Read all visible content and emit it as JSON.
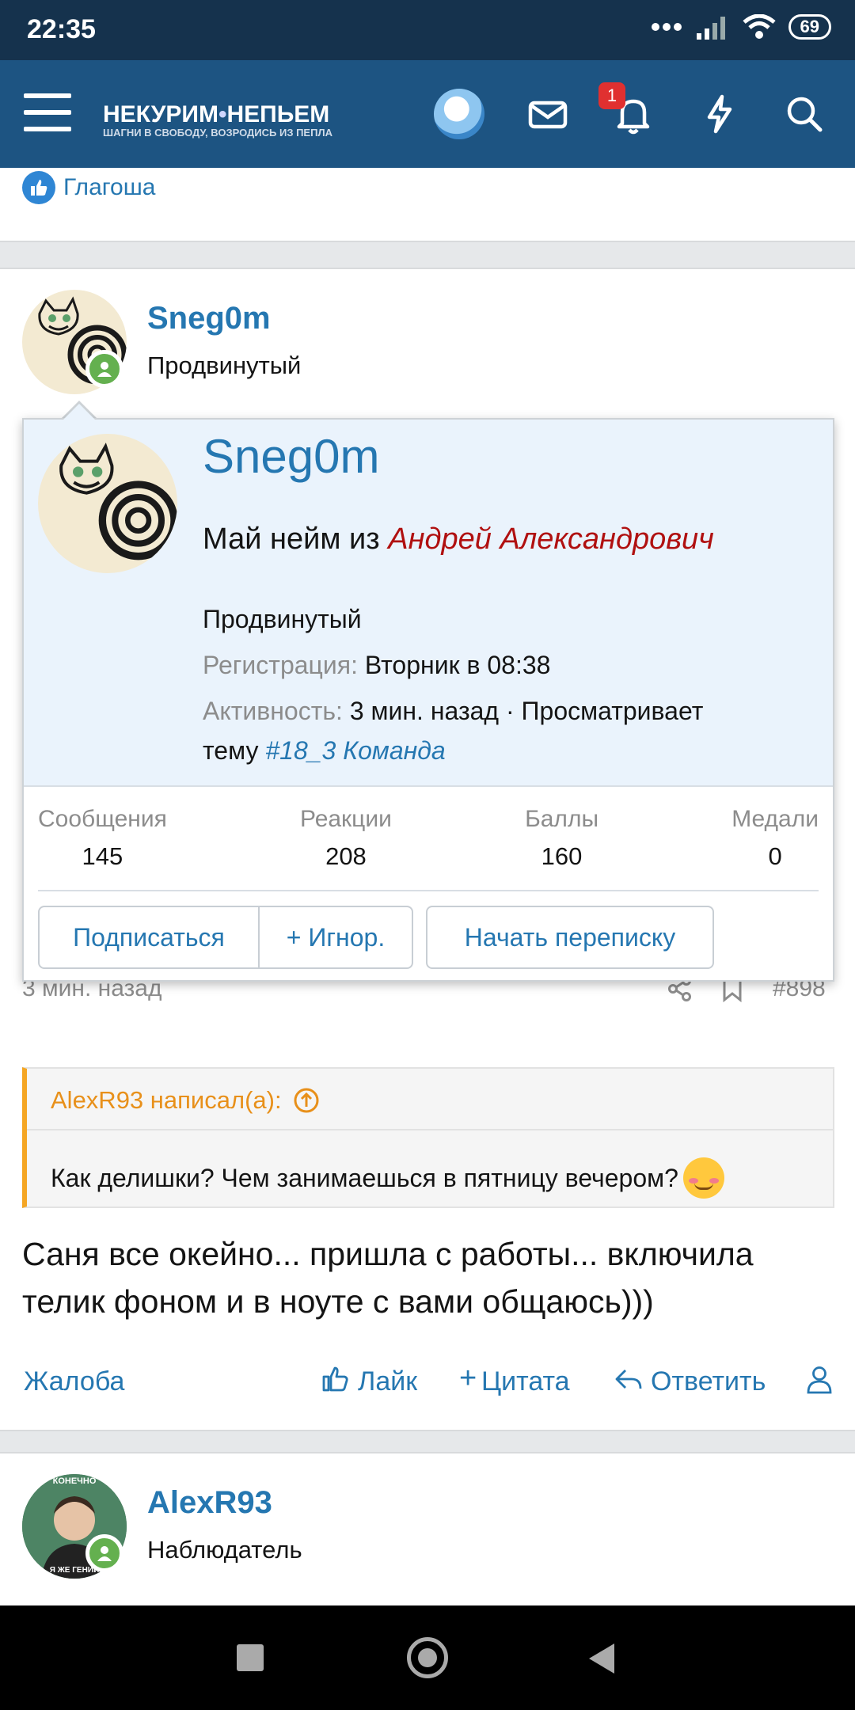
{
  "status_bar": {
    "time": "22:35",
    "battery": "69"
  },
  "header": {
    "logo_line1": "НЕКУРИМ",
    "logo_dot": "•",
    "logo_line1b": "НЕПЬЕМ",
    "logo_line2": "ШАГНИ В СВОБОДУ, ВОЗРОДИСЬ ИЗ ПЕПЛА",
    "notifications_count": "1"
  },
  "prev_post": {
    "liked_by": "Глагоша"
  },
  "post": {
    "author": "Sneg0m",
    "author_title": "Продвинутый",
    "time": "3 мин. назад",
    "number": "#898",
    "quote_author": "AlexR93 написал(а):",
    "quote_text": "Как делишки? Чем занимаешься в пятницу вечером?",
    "quote_emoji": "☺",
    "text": "Саня все окейно... пришла с работы... включила телик фоном и в ноуте с вами общаюсь)))",
    "actions": {
      "report": "Жалоба",
      "like": "Лайк",
      "quote": "Цитата",
      "reply": "Ответить"
    }
  },
  "member_card": {
    "name": "Sneg0m",
    "custom_prefix": "Май нейм из",
    "custom_title": "Андрей Александрович",
    "user_title": "Продвинутый",
    "registered_label": "Регистрация:",
    "registered_value": "Вторник в 08:38",
    "activity_label": "Активность:",
    "activity_value": "3 мин. назад · Просматривает",
    "activity_topic_prefix": "тему",
    "activity_topic": "#18_3 Команда",
    "stats": [
      {
        "label": "Сообщения",
        "value": "145"
      },
      {
        "label": "Реакции",
        "value": "208"
      },
      {
        "label": "Баллы",
        "value": "160"
      },
      {
        "label": "Медали",
        "value": "0"
      }
    ],
    "buttons": {
      "follow": "Подписаться",
      "ignore": "+ Игнор.",
      "message": "Начать переписку"
    }
  },
  "next_post": {
    "author": "AlexR93",
    "author_title": "Наблюдатель"
  },
  "colors": {
    "appbar": "#1d5482",
    "statusbar": "#15324d",
    "link": "#2577b1",
    "quote_accent": "#f5a623",
    "custom_title": "#b01010",
    "card_bg": "#eaf3fc"
  }
}
